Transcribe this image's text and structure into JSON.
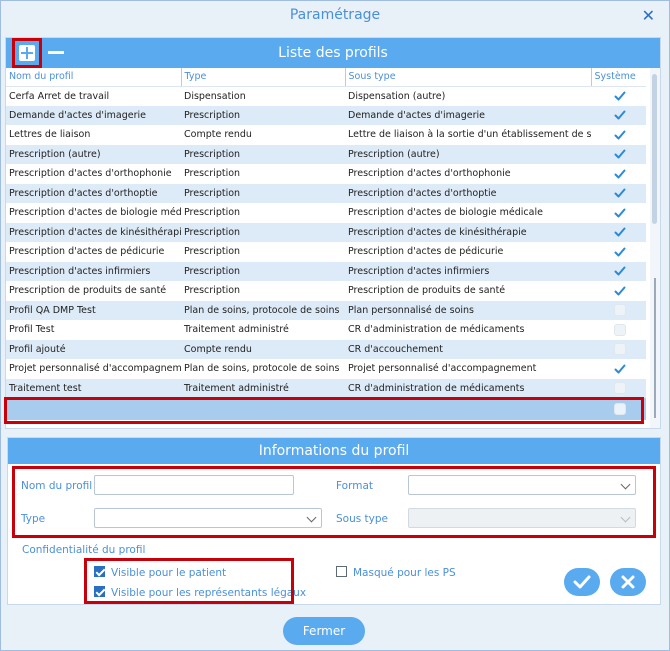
{
  "window": {
    "title": "Paramétrage"
  },
  "profiles": {
    "title": "Liste des profils",
    "columns": [
      "Nom du profil",
      "Type",
      "Sous type",
      "Système"
    ],
    "rows": [
      {
        "name": "Cerfa Arret de travail",
        "type": "Dispensation",
        "subtype": "Dispensation (autre)",
        "system": true
      },
      {
        "name": "Demande d'actes d'imagerie",
        "type": "Prescription",
        "subtype": "Demande d'actes d'imagerie",
        "system": true
      },
      {
        "name": "Lettres de liaison",
        "type": "Compte rendu",
        "subtype": "Lettre de liaison à la sortie d'un établissement de soins",
        "system": true
      },
      {
        "name": "Prescription (autre)",
        "type": "Prescription",
        "subtype": "Prescription (autre)",
        "system": true
      },
      {
        "name": "Prescription d'actes d'orthophonie",
        "type": "Prescription",
        "subtype": "Prescription d'actes d'orthophonie",
        "system": true
      },
      {
        "name": "Prescription d'actes d'orthoptie",
        "type": "Prescription",
        "subtype": "Prescription d'actes d'orthoptie",
        "system": true
      },
      {
        "name": "Prescription d'actes de biologie médicale",
        "type": "Prescription",
        "subtype": "Prescription d'actes de biologie médicale",
        "system": true
      },
      {
        "name": "Prescription d'actes de kinésithérapie",
        "type": "Prescription",
        "subtype": "Prescription d'actes de kinésithérapie",
        "system": true
      },
      {
        "name": "Prescription d'actes de pédicurie",
        "type": "Prescription",
        "subtype": "Prescription d'actes de pédicurie",
        "system": true
      },
      {
        "name": "Prescription d'actes infirmiers",
        "type": "Prescription",
        "subtype": "Prescription d'actes infirmiers",
        "system": true
      },
      {
        "name": "Prescription de produits de santé",
        "type": "Prescription",
        "subtype": "Prescription de produits de santé",
        "system": true
      },
      {
        "name": "Profil QA DMP Test",
        "type": "Plan de soins, protocole de soins",
        "subtype": "Plan personnalisé de soins",
        "system": false
      },
      {
        "name": "Profil Test",
        "type": "Traitement administré",
        "subtype": "CR d'administration de médicaments",
        "system": false
      },
      {
        "name": "Profil ajouté",
        "type": "Compte rendu",
        "subtype": "CR d'accouchement",
        "system": false
      },
      {
        "name": "Projet personnalisé d'accompagnement",
        "type": "Plan de soins, protocole de soins",
        "subtype": "Projet personnalisé d'accompagnement",
        "system": true
      },
      {
        "name": "Traitement test",
        "type": "Traitement administré",
        "subtype": "CR d'administration de médicaments",
        "system": false
      }
    ]
  },
  "info": {
    "title": "Informations du profil",
    "name_label": "Nom du profil",
    "name_value": "",
    "format_label": "Format",
    "format_value": "",
    "type_label": "Type",
    "type_value": "",
    "subtype_label": "Sous type",
    "subtype_value": "",
    "confidentiality_label": "Confidentialité du profil",
    "visible_patient_label": "Visible pour le patient",
    "visible_patient_checked": true,
    "visible_legal_label": "Visible pour les représentants légaux",
    "visible_legal_checked": true,
    "hidden_ps_label": "Masqué pour les PS",
    "hidden_ps_checked": false
  },
  "footer": {
    "close_label": "Fermer"
  },
  "colors": {
    "accent": "#5aaaf0",
    "highlight": "#c8000a",
    "label": "#4a90d9"
  }
}
